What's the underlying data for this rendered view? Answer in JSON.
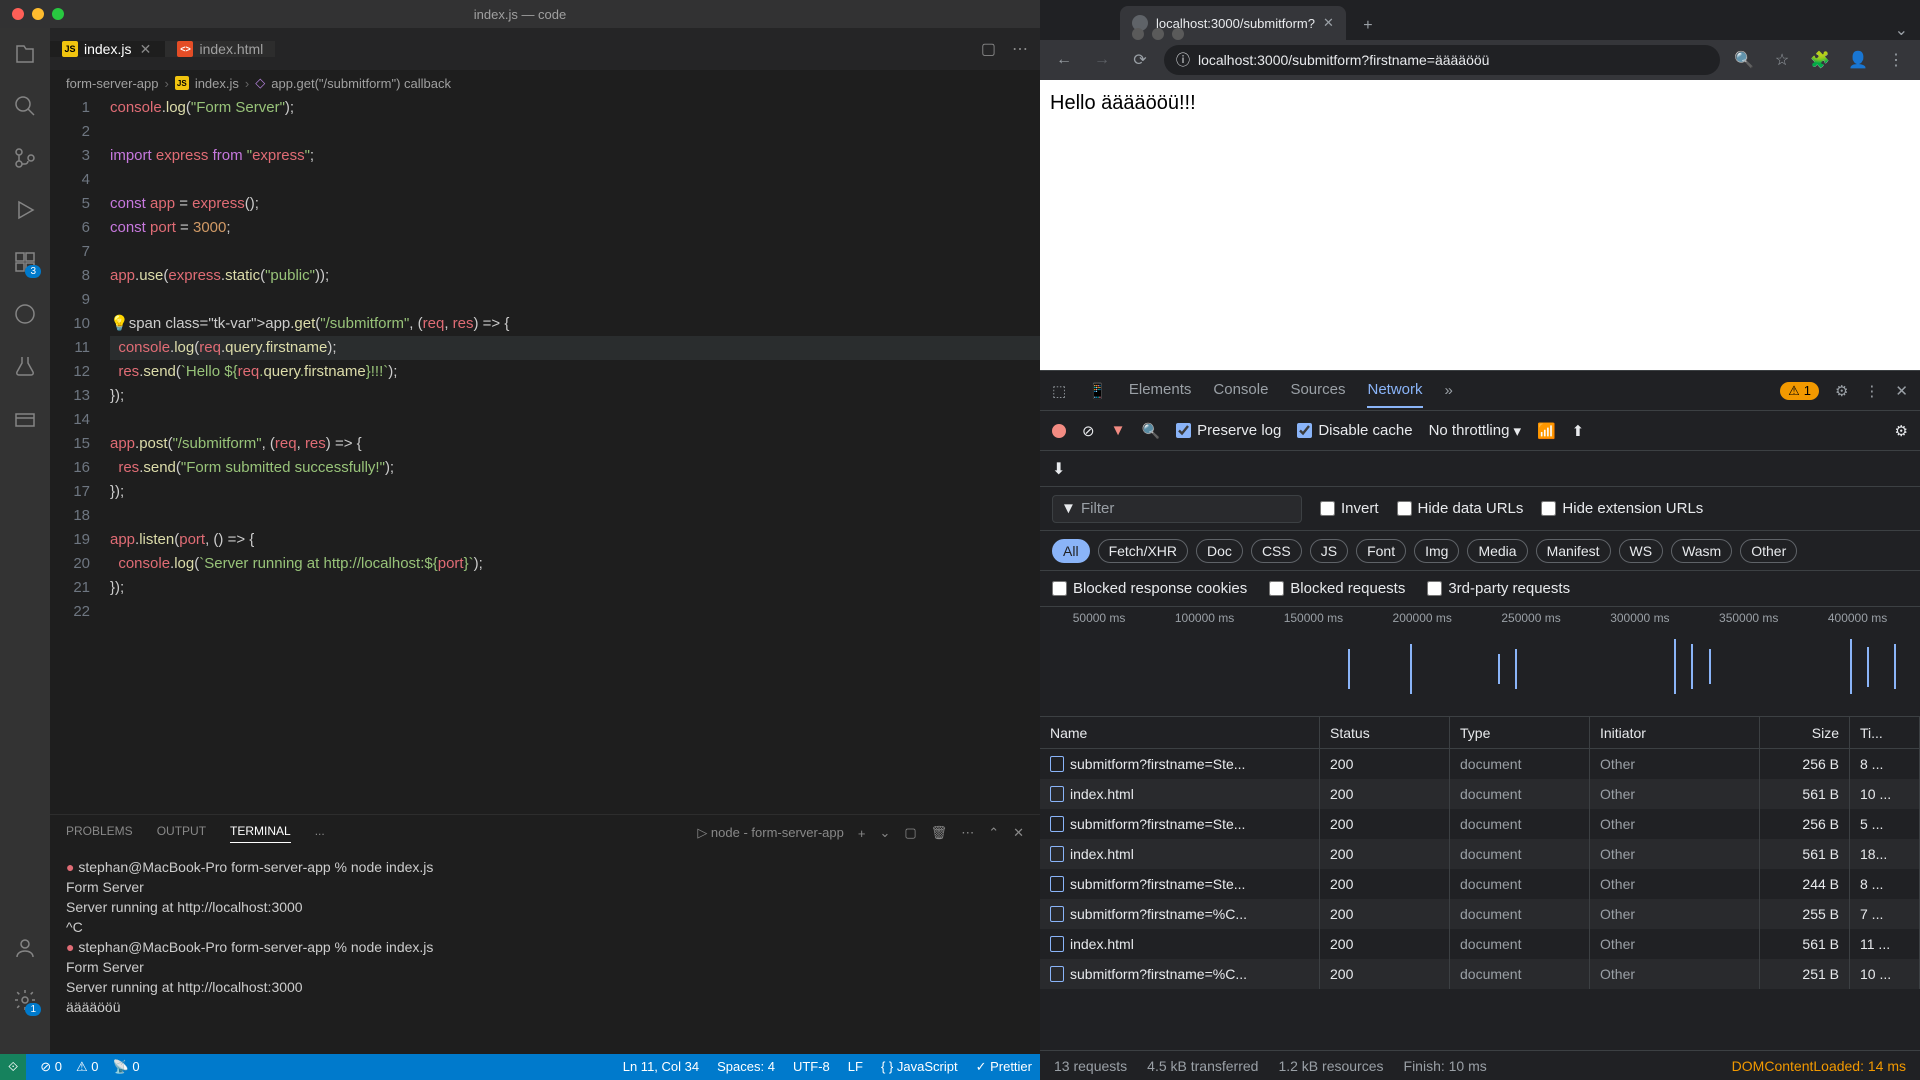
{
  "vscode": {
    "title": "index.js — code",
    "tabs": [
      {
        "name": "index.js",
        "icon": "JS",
        "active": true
      },
      {
        "name": "index.html",
        "icon": "<>",
        "active": false
      }
    ],
    "breadcrumb": {
      "folder": "form-server-app",
      "file": "index.js",
      "symbol": "app.get(\"/submitform\") callback"
    },
    "code_lines": [
      "console.log(\"Form Server\");",
      "",
      "import express from \"express\";",
      "",
      "const app = express();",
      "const port = 3000;",
      "",
      "app.use(express.static(\"public\"));",
      "",
      "app.get(\"/submitform\", (req, res) => {",
      "  console.log(req.query.firstname);",
      "  res.send(`Hello ${req.query.firstname}!!!`);",
      "});",
      "",
      "app.post(\"/submitform\", (req, res) => {",
      "  res.send(\"Form submitted successfully!\");",
      "});",
      "",
      "app.listen(port, () => {",
      "  console.log(`Server running at http://localhost:${port}`);",
      "});",
      ""
    ],
    "highlighted_line": 11,
    "panel": {
      "tabs": [
        "PROBLEMS",
        "OUTPUT",
        "TERMINAL",
        "..."
      ],
      "active": "TERMINAL",
      "task": "node - form-server-app"
    },
    "terminal_lines": [
      {
        "prompt": true,
        "text": "stephan@MacBook-Pro form-server-app % node index.js"
      },
      {
        "text": "Form Server"
      },
      {
        "text": "Server running at http://localhost:3000"
      },
      {
        "text": "^C"
      },
      {
        "prompt": true,
        "text": "stephan@MacBook-Pro form-server-app % node index.js"
      },
      {
        "text": "Form Server"
      },
      {
        "text": "Server running at http://localhost:3000"
      },
      {
        "text": "ääääööü"
      }
    ],
    "statusbar": {
      "errors": "0",
      "warnings": "0",
      "port": "0",
      "position": "Ln 11, Col 34",
      "spaces": "Spaces: 4",
      "encoding": "UTF-8",
      "eol": "LF",
      "lang": "JavaScript",
      "prettier": "Prettier"
    }
  },
  "chrome": {
    "tab_title": "localhost:3000/submitform?",
    "url": "localhost:3000/submitform?firstname=ääääööü",
    "page_text": "Hello ääääööü!!!"
  },
  "devtools": {
    "tabs": [
      "Elements",
      "Console",
      "Sources",
      "Network"
    ],
    "active_tab": "Network",
    "warning_count": "1",
    "toolbar": {
      "preserve_log": "Preserve log",
      "disable_cache": "Disable cache",
      "throttling": "No throttling"
    },
    "filter_placeholder": "Filter",
    "filter_checks": [
      "Invert",
      "Hide data URLs",
      "Hide extension URLs"
    ],
    "type_filters": [
      "All",
      "Fetch/XHR",
      "Doc",
      "CSS",
      "JS",
      "Font",
      "Img",
      "Media",
      "Manifest",
      "WS",
      "Wasm",
      "Other"
    ],
    "active_type": "All",
    "blocked_checks": [
      "Blocked response cookies",
      "Blocked requests",
      "3rd-party requests"
    ],
    "timeline_ticks": [
      "50000 ms",
      "100000 ms",
      "150000 ms",
      "200000 ms",
      "250000 ms",
      "300000 ms",
      "350000 ms",
      "400000 ms"
    ],
    "columns": [
      "Name",
      "Status",
      "Type",
      "Initiator",
      "Size",
      "Ti..."
    ],
    "rows": [
      {
        "name": "submitform?firstname=Ste...",
        "status": "200",
        "type": "document",
        "initiator": "Other",
        "size": "256 B",
        "time": "8 ..."
      },
      {
        "name": "index.html",
        "status": "200",
        "type": "document",
        "initiator": "Other",
        "size": "561 B",
        "time": "10 ..."
      },
      {
        "name": "submitform?firstname=Ste...",
        "status": "200",
        "type": "document",
        "initiator": "Other",
        "size": "256 B",
        "time": "5 ..."
      },
      {
        "name": "index.html",
        "status": "200",
        "type": "document",
        "initiator": "Other",
        "size": "561 B",
        "time": "18..."
      },
      {
        "name": "submitform?firstname=Ste...",
        "status": "200",
        "type": "document",
        "initiator": "Other",
        "size": "244 B",
        "time": "8 ..."
      },
      {
        "name": "submitform?firstname=%C...",
        "status": "200",
        "type": "document",
        "initiator": "Other",
        "size": "255 B",
        "time": "7 ..."
      },
      {
        "name": "index.html",
        "status": "200",
        "type": "document",
        "initiator": "Other",
        "size": "561 B",
        "time": "11 ..."
      },
      {
        "name": "submitform?firstname=%C...",
        "status": "200",
        "type": "document",
        "initiator": "Other",
        "size": "251 B",
        "time": "10 ..."
      }
    ],
    "status": {
      "requests": "13 requests",
      "transferred": "4.5 kB transferred",
      "resources": "1.2 kB resources",
      "finish": "Finish: 10 ms",
      "dom": "DOMContentLoaded: 14 ms"
    }
  }
}
